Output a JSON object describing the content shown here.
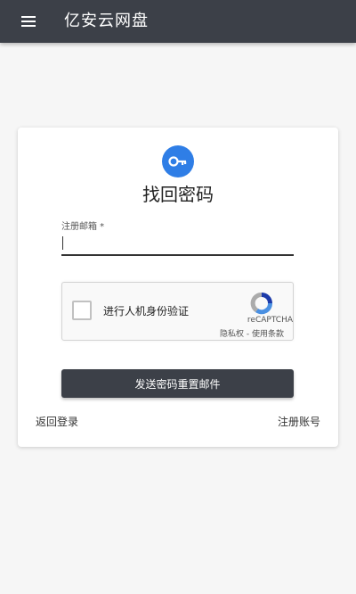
{
  "app_bar": {
    "title": "亿安云网盘",
    "menu_icon": "hamburger-menu-icon",
    "background": "#3c4048"
  },
  "card": {
    "icon": "key-icon",
    "icon_color": "#2f7ee6",
    "title": "找回密码",
    "email": {
      "label": "注册邮箱 *",
      "value": ""
    },
    "recaptcha": {
      "checkbox_label": "进行人机身份验证",
      "brand": "reCAPTCHA",
      "privacy": "隐私权",
      "separator": "-",
      "terms": "使用条款"
    },
    "submit_label": "发送密码重置邮件",
    "back_to_login": "返回登录",
    "register": "注册账号"
  }
}
